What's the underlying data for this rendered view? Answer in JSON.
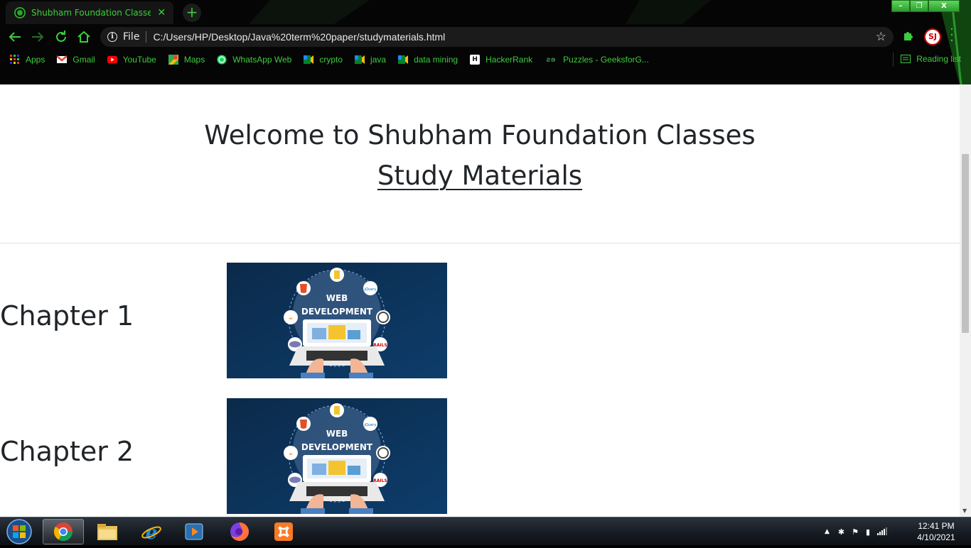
{
  "browser": {
    "tab": {
      "title": "Shubham Foundation Classes | H",
      "close_icon": "close-icon"
    },
    "new_tab_symbol": "+",
    "window_controls": {
      "minimize": "–",
      "restore": "❐",
      "close": "X"
    },
    "omnibox": {
      "scheme_label": "File",
      "url": "C:/Users/HP/Desktop/Java%20term%20paper/studymaterials.html"
    },
    "profile_initials": "SJ",
    "bookmarks": [
      {
        "label": "Apps",
        "icon": "apps-grid-icon"
      },
      {
        "label": "Gmail",
        "icon": "gmail-icon"
      },
      {
        "label": "YouTube",
        "icon": "youtube-icon"
      },
      {
        "label": "Maps",
        "icon": "maps-icon"
      },
      {
        "label": "WhatsApp Web",
        "icon": "whatsapp-icon"
      },
      {
        "label": "crypto",
        "icon": "meet-icon"
      },
      {
        "label": "java",
        "icon": "meet-icon"
      },
      {
        "label": "data mining",
        "icon": "meet-icon"
      },
      {
        "label": "HackerRank",
        "icon": "hackerrank-icon"
      },
      {
        "label": "Puzzles - GeeksforG...",
        "icon": "geeksforgeeks-icon"
      }
    ],
    "reading_list": "Reading list",
    "accent_color": "#3ccd3c"
  },
  "page": {
    "heading": "Welcome to Shubham Foundation Classes",
    "subheading": "Study Materials",
    "chapters": [
      {
        "title": "Chapter 1",
        "image": {
          "line1": "WEB",
          "line2": "DEVELOPMENT",
          "icons": [
            "html5-icon",
            "nodejs-icon",
            "jquery-icon",
            "wordpress-icon",
            "rails-icon",
            "php-icon",
            "java-icon"
          ]
        }
      },
      {
        "title": "Chapter 2",
        "image": {
          "line1": "WEB",
          "line2": "DEVELOPMENT",
          "icons": [
            "html5-icon",
            "nodejs-icon",
            "jquery-icon",
            "wordpress-icon",
            "rails-icon",
            "php-icon",
            "java-icon"
          ]
        }
      }
    ]
  },
  "taskbar": {
    "apps": [
      "chrome-icon",
      "file-explorer-icon",
      "internet-explorer-icon",
      "media-player-icon",
      "firefox-icon",
      "xampp-icon"
    ],
    "clock": {
      "time": "12:41 PM",
      "date": "4/10/2021"
    }
  }
}
